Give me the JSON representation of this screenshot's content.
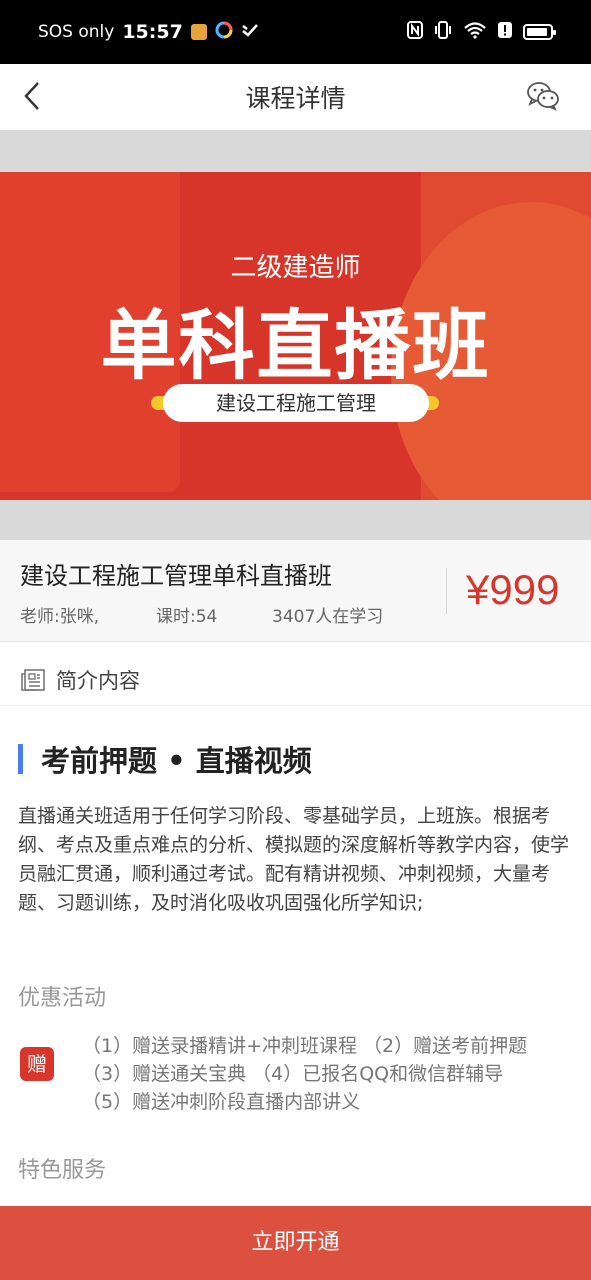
{
  "status_bar": {
    "carrier": "SOS only",
    "time": "15:57",
    "icons": [
      "app-icon-orange",
      "app-icon-colorful",
      "app-icon-check",
      "nfc-icon",
      "vibrate-icon",
      "wifi-6-icon",
      "alert-icon",
      "battery-icon"
    ]
  },
  "nav": {
    "title": "课程详情",
    "back_icon": "chevron-left-icon",
    "share_icon": "wechat-icon"
  },
  "banner": {
    "subtitle": "二级建造师",
    "title": "单科直播班",
    "pill_text": "建设工程施工管理",
    "colors": {
      "bg": "#d7352a",
      "accent": "#f5c72e"
    }
  },
  "course": {
    "name": "建设工程施工管理单科直播班",
    "teacher": "老师:张咪,",
    "hours": "课时:54",
    "learners": "3407人在学习",
    "price": "¥999",
    "price_color": "#d9362b"
  },
  "intro": {
    "header_label": "简介内容",
    "header_icon": "document-icon",
    "section_title": "考前押题 • 直播视频",
    "description": "直播通关班适用于任何学习阶段、零基础学员，上班族。根据考纲、考点及重点难点的分析、模拟题的深度解析等教学内容，使学员融汇贯通，顺利通过考试。配有精讲视频、冲刺视频，大量考题、习题训练，及时消化吸收巩固强化所学知识;",
    "promo_label": "优惠活动",
    "gift_badge": "赠",
    "promo_lines": [
      "（1）赠送录播精讲+冲刺班课程 （2）赠送考前押题",
      "（3）赠送通关宝典 （4）已报名QQ和微信群辅导",
      "（5）赠送冲刺阶段直播内部讲义"
    ],
    "feature_label": "特色服务"
  },
  "action": {
    "open_label": "立即开通",
    "color": "#dc503f"
  }
}
